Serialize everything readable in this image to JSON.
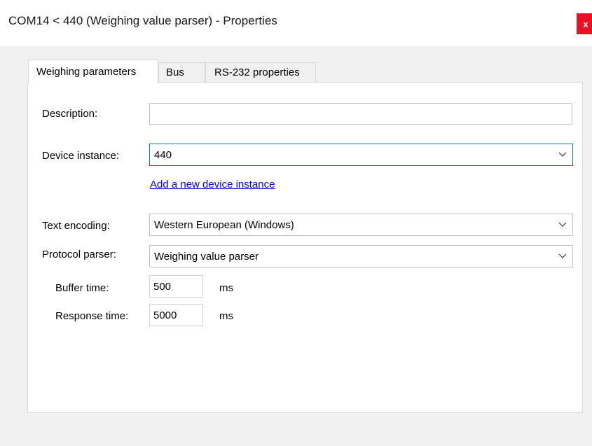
{
  "window": {
    "title": "COM14 < 440 (Weighing value parser) - Properties",
    "close_label": "x"
  },
  "tabs": [
    {
      "label": "Weighing parameters",
      "active": true
    },
    {
      "label": "Bus",
      "active": false
    },
    {
      "label": "RS-232 properties",
      "active": false
    }
  ],
  "form": {
    "description": {
      "label": "Description:",
      "value": ""
    },
    "device_instance": {
      "label": "Device instance:",
      "value": "440"
    },
    "add_instance_link": "Add a new device instance",
    "text_encoding": {
      "label": "Text encoding:",
      "value": "Western European (Windows)"
    },
    "protocol_parser": {
      "label": "Protocol parser:",
      "value": "Weighing value parser"
    },
    "buffer_time": {
      "label": "Buffer time:",
      "value": "500",
      "unit": "ms"
    },
    "response_time": {
      "label": "Response time:",
      "value": "5000",
      "unit": "ms"
    }
  },
  "icons": {
    "dropdown": "chevron-down-icon"
  }
}
